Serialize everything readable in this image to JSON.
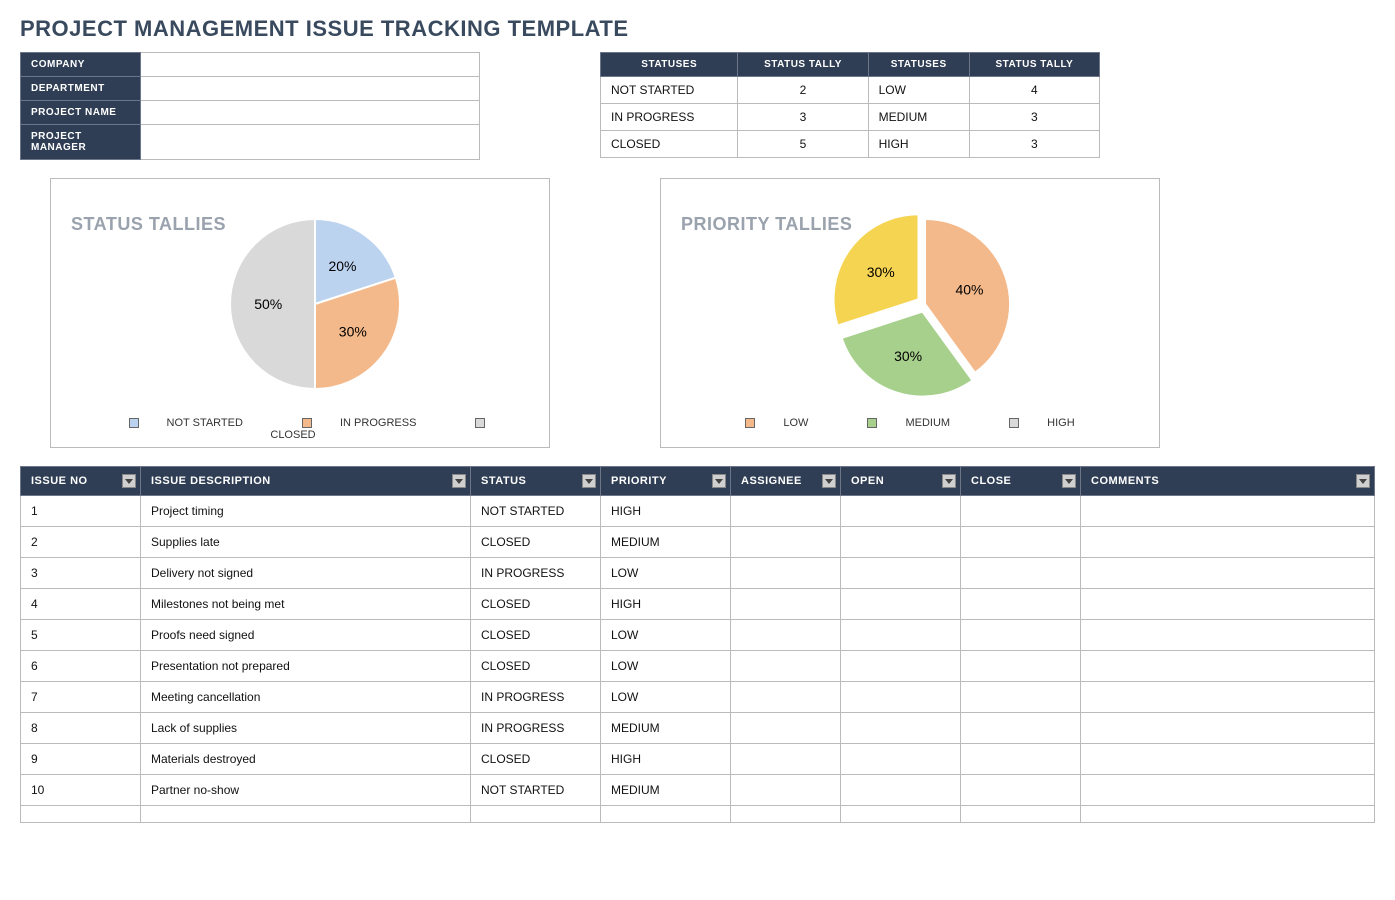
{
  "title": "PROJECT MANAGEMENT ISSUE TRACKING TEMPLATE",
  "info": {
    "labels": {
      "company": "COMPANY",
      "department": "DEPARTMENT",
      "project_name": "PROJECT NAME",
      "project_manager": "PROJECT MANAGER"
    },
    "values": {
      "company": "",
      "department": "",
      "project_name": "",
      "project_manager": ""
    }
  },
  "tally": {
    "headers": {
      "statuses": "STATUSES",
      "status_tally": "STATUS TALLY"
    },
    "status_rows": [
      {
        "label": "NOT STARTED",
        "count": 2
      },
      {
        "label": "IN PROGRESS",
        "count": 3
      },
      {
        "label": "CLOSED",
        "count": 5
      }
    ],
    "priority_rows": [
      {
        "label": "LOW",
        "count": 4
      },
      {
        "label": "MEDIUM",
        "count": 3
      },
      {
        "label": "HIGH",
        "count": 3
      }
    ]
  },
  "charts": {
    "status": {
      "title": "STATUS TALLIES",
      "legend": {
        "not_started": "NOT STARTED",
        "in_progress": "IN PROGRESS",
        "closed": "CLOSED"
      }
    },
    "priority": {
      "title": "PRIORITY TALLIES",
      "legend": {
        "low": "LOW",
        "medium": "MEDIUM",
        "high": "HIGH"
      }
    }
  },
  "issues": {
    "headers": {
      "no": "ISSUE NO",
      "desc": "ISSUE DESCRIPTION",
      "status": "STATUS",
      "priority": "PRIORITY",
      "assignee": "ASSIGNEE",
      "open": "OPEN",
      "close": "CLOSE",
      "comments": "COMMENTS"
    },
    "rows": [
      {
        "no": "1",
        "desc": "Project timing",
        "status": "NOT STARTED",
        "priority": "HIGH",
        "assignee": "",
        "open": "",
        "close": "",
        "comments": ""
      },
      {
        "no": "2",
        "desc": "Supplies late",
        "status": "CLOSED",
        "priority": "MEDIUM",
        "assignee": "",
        "open": "",
        "close": "",
        "comments": ""
      },
      {
        "no": "3",
        "desc": "Delivery not signed",
        "status": "IN PROGRESS",
        "priority": "LOW",
        "assignee": "",
        "open": "",
        "close": "",
        "comments": ""
      },
      {
        "no": "4",
        "desc": "Milestones not being met",
        "status": "CLOSED",
        "priority": "HIGH",
        "assignee": "",
        "open": "",
        "close": "",
        "comments": ""
      },
      {
        "no": "5",
        "desc": "Proofs need signed",
        "status": "CLOSED",
        "priority": "LOW",
        "assignee": "",
        "open": "",
        "close": "",
        "comments": ""
      },
      {
        "no": "6",
        "desc": "Presentation not prepared",
        "status": "CLOSED",
        "priority": "LOW",
        "assignee": "",
        "open": "",
        "close": "",
        "comments": ""
      },
      {
        "no": "7",
        "desc": "Meeting cancellation",
        "status": "IN PROGRESS",
        "priority": "LOW",
        "assignee": "",
        "open": "",
        "close": "",
        "comments": ""
      },
      {
        "no": "8",
        "desc": "Lack of supplies",
        "status": "IN PROGRESS",
        "priority": "MEDIUM",
        "assignee": "",
        "open": "",
        "close": "",
        "comments": ""
      },
      {
        "no": "9",
        "desc": "Materials destroyed",
        "status": "CLOSED",
        "priority": "HIGH",
        "assignee": "",
        "open": "",
        "close": "",
        "comments": ""
      },
      {
        "no": "10",
        "desc": "Partner no-show",
        "status": "NOT STARTED",
        "priority": "MEDIUM",
        "assignee": "",
        "open": "",
        "close": "",
        "comments": ""
      },
      {
        "no": "",
        "desc": "",
        "status": "",
        "priority": "",
        "assignee": "",
        "open": "",
        "close": "",
        "comments": ""
      }
    ]
  },
  "chart_data": [
    {
      "type": "pie",
      "title": "STATUS TALLIES",
      "categories": [
        "NOT STARTED",
        "IN PROGRESS",
        "CLOSED"
      ],
      "values": [
        20,
        30,
        50
      ],
      "data_labels": [
        "20%",
        "30%",
        "50%"
      ],
      "colors": [
        "#bcd3f0",
        "#f3b98a",
        "#d9d9d9"
      ]
    },
    {
      "type": "pie",
      "title": "PRIORITY TALLIES",
      "categories": [
        "LOW",
        "MEDIUM",
        "HIGH"
      ],
      "values": [
        40,
        30,
        30
      ],
      "data_labels": [
        "40%",
        "30%",
        "30%"
      ],
      "colors": [
        "#f3b98a",
        "#a7d08c",
        "#f5d452"
      ]
    }
  ]
}
